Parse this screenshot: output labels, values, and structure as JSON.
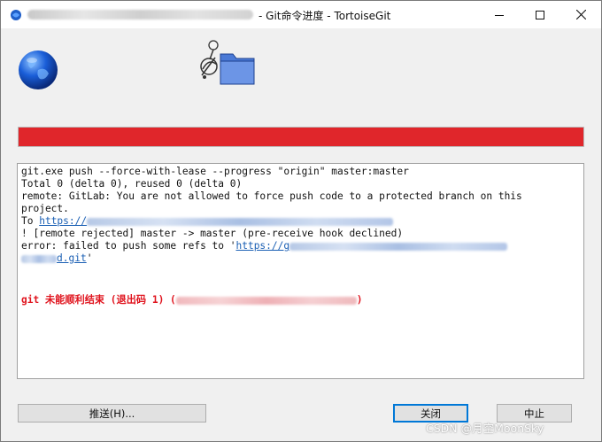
{
  "window": {
    "title": "- Git命令进度 - TortoiseGit"
  },
  "progress": {
    "percent": 100,
    "status_color": "#e0262b"
  },
  "log": {
    "lines": [
      "git.exe push --force-with-lease --progress \"origin\" master:master",
      "Total 0 (delta 0), reused 0 (delta 0)",
      "remote: GitLab: You are not allowed to force push code to a protected branch on this",
      "project.",
      "To ",
      "! [remote rejected] master -> master (pre-receive hook declined)",
      "error: failed to push some refs to '"
    ],
    "url_prefix": "https://",
    "url_prefix_2": "https://g",
    "url_suffix": "d.git",
    "url_close": "'",
    "error_text": "git 未能顺利结束 (退出码 1) ("
  },
  "buttons": {
    "push": "推送(H)...",
    "close": "关闭",
    "abort": "中止"
  },
  "watermark": "CSDN @月空MoonSky",
  "colors": {
    "error_red": "#e0141e",
    "link_blue": "#1a5fb4",
    "accent_blue": "#0078d7"
  }
}
